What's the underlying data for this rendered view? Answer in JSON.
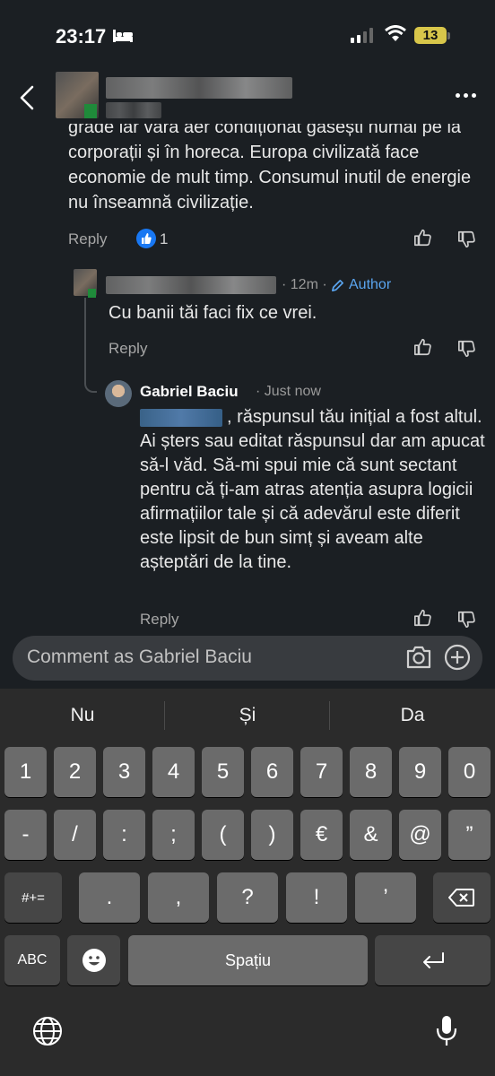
{
  "status_bar": {
    "time": "23:17",
    "battery": "13"
  },
  "post": {
    "text": "grade iar vara aer condiționat găsești numai pe la corporații și în horeca. Europa civilizată face economie de mult timp. Consumul inutil de energie nu înseamnă civilizație.",
    "reply_label": "Reply",
    "like_count": "1"
  },
  "comment1": {
    "time": "· 12m ·",
    "author_badge": "Author",
    "text": "Cu banii tăi faci fix ce vrei.",
    "reply_label": "Reply"
  },
  "comment2": {
    "name": "Gabriel Baciu",
    "time": "· Just now",
    "text": ", răspunsul tău inițial a fost altul. Ai șters sau editat răspunsul dar am apucat să-l văd. Să-mi spui mie că sunt sectant pentru că ți-am atras atenția asupra logicii afirmațiilor tale și că adevărul este diferit este lipsit de bun simț și aveam alte așteptări de la tine.",
    "reply_label": "Reply"
  },
  "comment_box": {
    "placeholder": "Comment as Gabriel Baciu"
  },
  "keyboard": {
    "suggestions": [
      "Nu",
      "Și",
      "Da"
    ],
    "row1": [
      "1",
      "2",
      "3",
      "4",
      "5",
      "6",
      "7",
      "8",
      "9",
      "0"
    ],
    "row2": [
      "-",
      "/",
      ":",
      ";",
      "(",
      ")",
      "€",
      "&",
      "@",
      "”"
    ],
    "row3": [
      ".",
      ",",
      "?",
      "!",
      "’"
    ],
    "shift_label": "#+=",
    "abc_label": "ABC",
    "space_label": "Spațiu"
  },
  "colors": {
    "background": "#1b1f23",
    "accent": "#5aa5f0",
    "like_blue": "#1877f2"
  }
}
